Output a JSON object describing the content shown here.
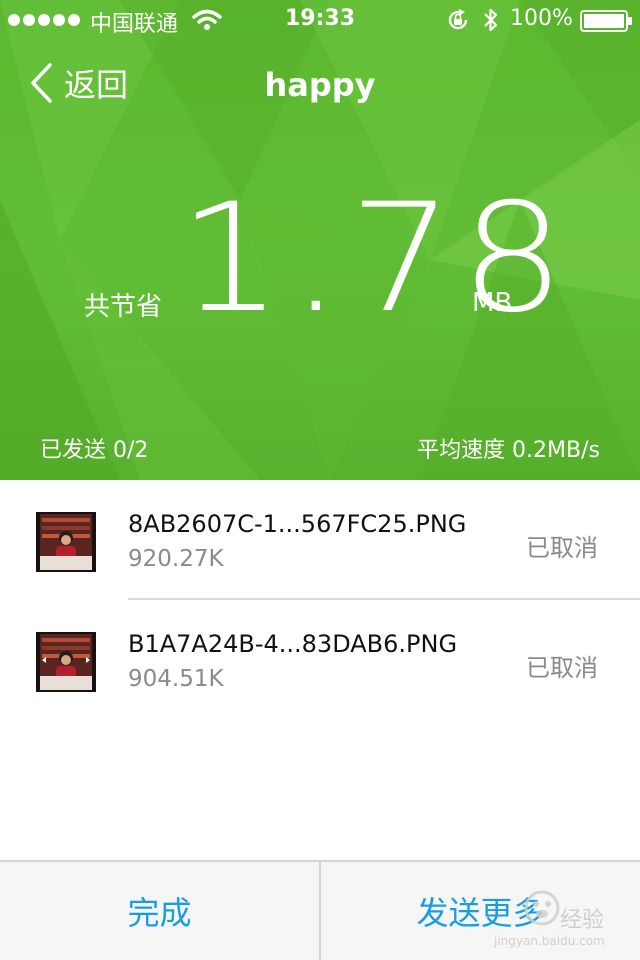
{
  "status_bar": {
    "carrier": "中国联通",
    "time": "19:33",
    "battery_percent": "100%"
  },
  "nav": {
    "back_label": "返回",
    "title": "happy"
  },
  "savings": {
    "label": "共节省",
    "value": "1.78",
    "unit": "MB"
  },
  "stats": {
    "sent": "已发送 0/2",
    "avg_speed": "平均速度 0.2MB/s"
  },
  "files": [
    {
      "name": "8AB2607C-1...567FC25.PNG",
      "size": "920.27K",
      "status": "已取消"
    },
    {
      "name": "B1A7A24B-4...83DAB6.PNG",
      "size": "904.51K",
      "status": "已取消"
    }
  ],
  "bottom": {
    "done_label": "完成",
    "send_more_label": "发送更多"
  },
  "watermark": {
    "text": "经验",
    "url": "jingyan.baidu.com"
  },
  "colors": {
    "header_green": "#5cb82f",
    "accent_blue": "#1a9de0",
    "muted_text": "#8a8a8a"
  }
}
